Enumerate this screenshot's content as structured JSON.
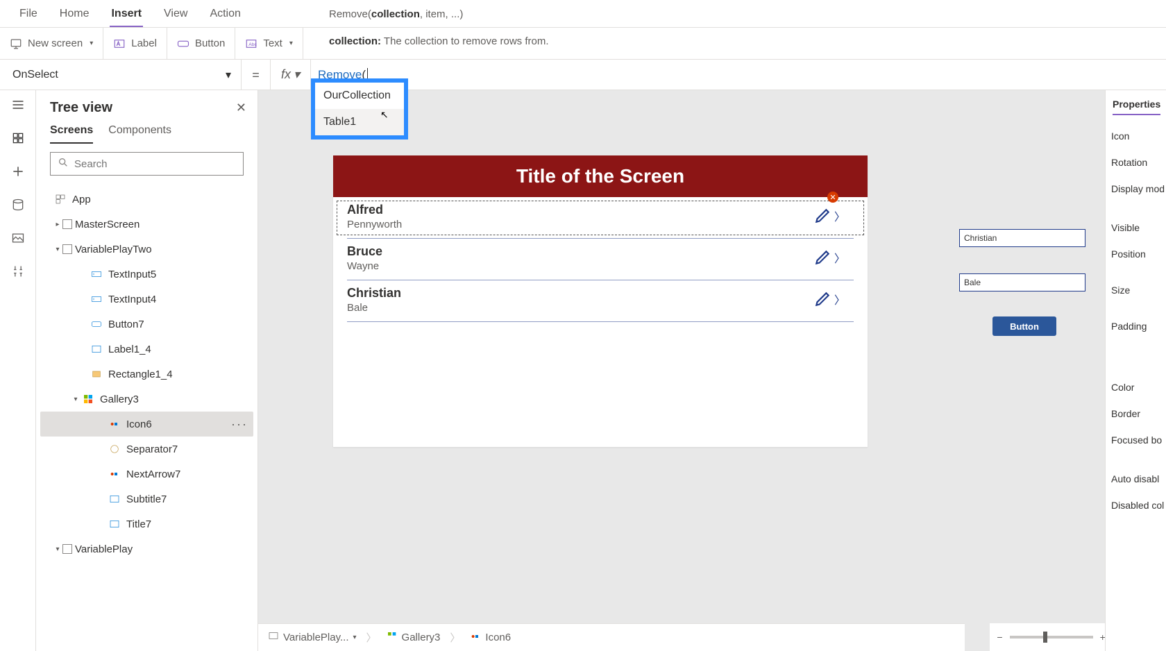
{
  "menu": {
    "items": [
      "File",
      "Home",
      "Insert",
      "View",
      "Action"
    ],
    "active": "Insert"
  },
  "ribbon": {
    "new_screen": "New screen",
    "label": "Label",
    "button": "Button",
    "text": "Text"
  },
  "hint": {
    "sig_fn": "Remove(",
    "sig_bold": "collection",
    "sig_rest": ", item, ...)",
    "desc_bold": "collection:",
    "desc_rest": " The collection to remove rows from."
  },
  "property": {
    "name": "OnSelect",
    "eq": "="
  },
  "fx": {
    "label": "fx"
  },
  "formula": {
    "kw": "Remove",
    "paren": "("
  },
  "autocomplete": {
    "items": [
      "OurCollection",
      "Table1"
    ]
  },
  "tree": {
    "title": "Tree view",
    "tabs": [
      "Screens",
      "Components"
    ],
    "search_ph": "Search",
    "nodes": {
      "app": "App",
      "master": "MasterScreen",
      "vpt": "VariablePlayTwo",
      "ti5": "TextInput5",
      "ti4": "TextInput4",
      "btn7": "Button7",
      "lbl14": "Label1_4",
      "rect14": "Rectangle1_4",
      "gal3": "Gallery3",
      "icon6": "Icon6",
      "sep7": "Separator7",
      "na7": "NextArrow7",
      "sub7": "Subtitle7",
      "tit7": "Title7",
      "vp": "VariablePlay"
    }
  },
  "screen": {
    "title": "Title of the Screen"
  },
  "gallery": [
    {
      "first": "Alfred",
      "last": "Pennyworth"
    },
    {
      "first": "Bruce",
      "last": "Wayne"
    },
    {
      "first": "Christian",
      "last": "Bale"
    }
  ],
  "inputs": {
    "a": "Christian",
    "b": "Bale"
  },
  "button_label": "Button",
  "breadcrumb": {
    "a": "VariablePlay...",
    "b": "Gallery3",
    "c": "Icon6"
  },
  "props": {
    "tab": "Properties",
    "rows": [
      "Icon",
      "Rotation",
      "Display mod",
      "Visible",
      "Position",
      "Size",
      "Padding",
      "Color",
      "Border",
      "Focused bo",
      "Auto disabl",
      "Disabled col"
    ]
  },
  "zoom": {
    "value": "50",
    "pct": "%"
  }
}
